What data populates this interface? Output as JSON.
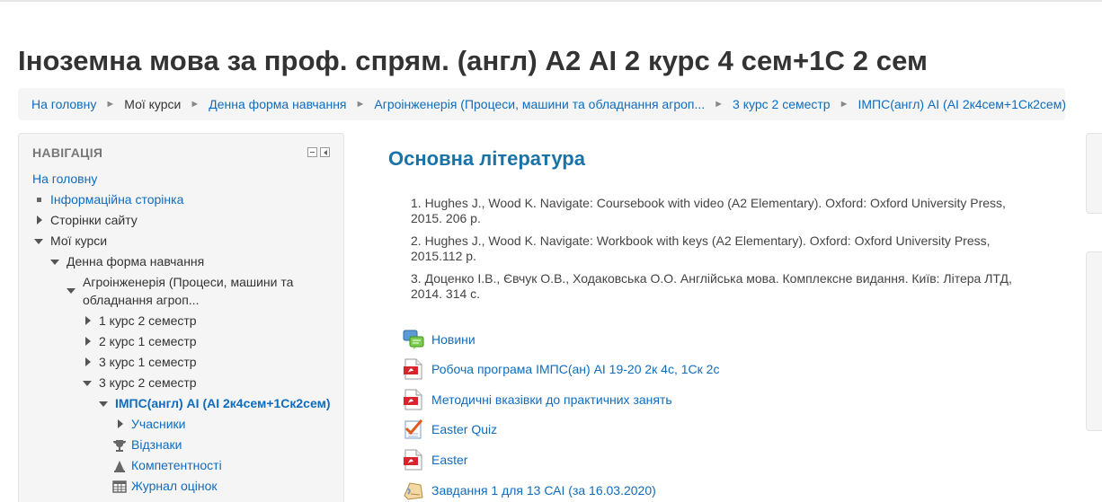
{
  "page": {
    "title": "Іноземна мова за проф. спрям. (англ) А2 АІ 2 курс 4 сем+1С 2 сем"
  },
  "breadcrumb": [
    {
      "label": "На головну",
      "link": true
    },
    {
      "label": "Мої курси",
      "link": false
    },
    {
      "label": "Денна форма навчання",
      "link": true
    },
    {
      "label": "Агроінженерія (Процеси, машини та обладнання агроп...",
      "link": true
    },
    {
      "label": "3 курс 2 семестр",
      "link": true
    },
    {
      "label": "ІМПС(англ) АІ (АІ 2к4сем+1Ск2сем)",
      "link": true
    }
  ],
  "navigation": {
    "header": "НАВІГАЦІЯ",
    "home": "На головну",
    "info_page": "Інформаційна сторінка",
    "site_pages": "Сторінки сайту",
    "my_courses": "Мої курси",
    "full_time": "Денна форма навчання",
    "agro_line1": "Агроінженерія (Процеси, машини та",
    "agro_line2": "обладнання агроп...",
    "y1s2": "1 курс 2 семестр",
    "y2s1": "2 курс 1 семестр",
    "y3s1": "3 курс 1 семестр",
    "y3s2": "3 курс 2 семестр",
    "course": "ІМПС(англ) АІ (АІ 2к4сем+1Ск2сем)",
    "participants": "Учасники",
    "badges": "Відзнаки",
    "competencies": "Компетентності",
    "grades": "Журнал оцінок"
  },
  "content": {
    "section_title": "Основна література",
    "literature": [
      "1. Hughes J., Wood K. Navigate: Coursebook with video (A2 Elementary).  Oxford: Oxford University Press, 2015. 206 p.",
      "2. Hughes J., Wood K. Navigate: Workbook with keys (A2 Elementary).  Oxford: Oxford University Press, 2015.112 p.",
      "3. Доценко І.В., Євчук О.В., Ходаковська О.О. Англійська мова. Комплексне видання. Київ: Літера ЛТД, 2014. 314 с."
    ],
    "activities": [
      {
        "label": "Новини",
        "icon": "forum-icon"
      },
      {
        "label": "Робоча програма ІМПС(ан) АІ 19-20 2к 4с, 1Ск 2с",
        "icon": "pdf-icon"
      },
      {
        "label": "Методичні вказівки до практичних занять",
        "icon": "pdf-icon"
      },
      {
        "label": "Easter Quiz",
        "icon": "quiz-icon"
      },
      {
        "label": "Easter",
        "icon": "pdf-icon"
      },
      {
        "label": "Завдання 1 для 13 САІ (за 16.03.2020)",
        "icon": "assignment-icon"
      }
    ]
  },
  "colors": {
    "link": "#0f6cbf",
    "heading": "#1a73a8",
    "breadcrumb_bg": "#f5f5f5",
    "pdf_red": "#d9232d"
  }
}
